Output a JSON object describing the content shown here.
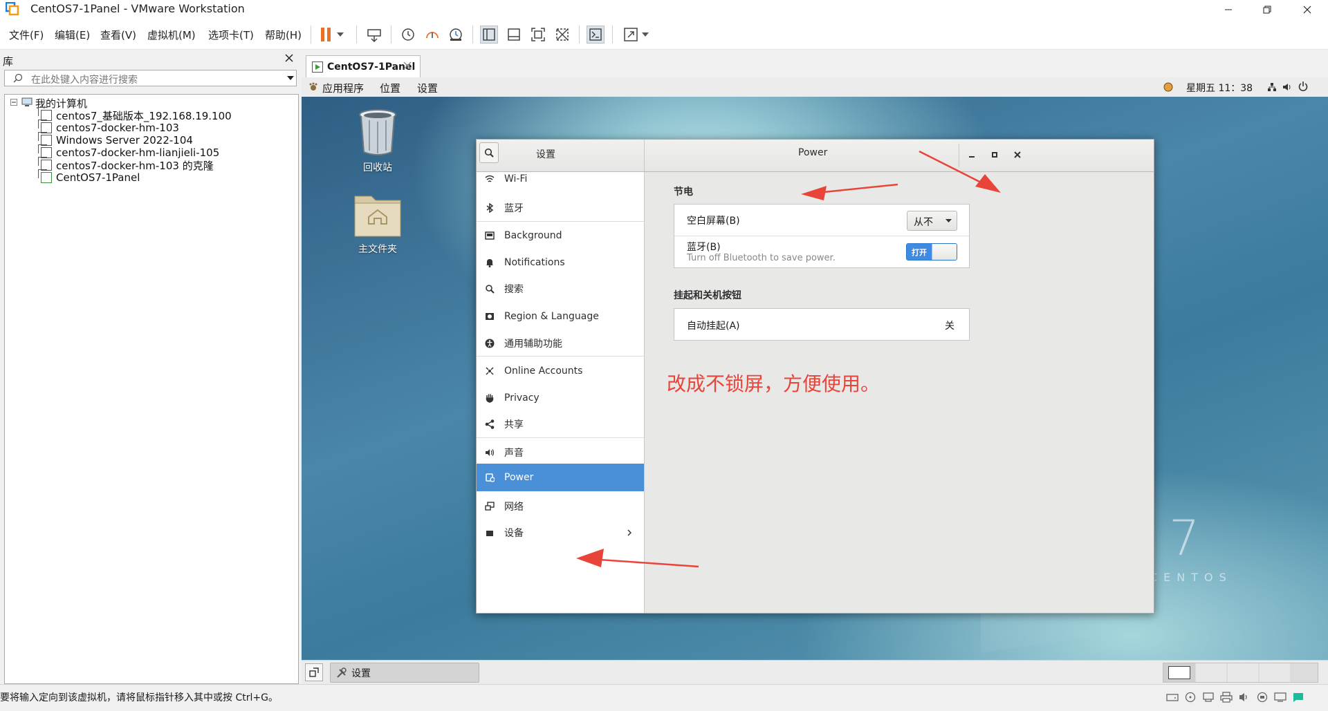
{
  "window": {
    "title": "CentOS7-1Panel - VMware Workstation"
  },
  "menu": [
    "文件(F)",
    "编辑(E)",
    "查看(V)",
    "虚拟机(M)",
    "选项卡(T)",
    "帮助(H)"
  ],
  "library": {
    "title": "库",
    "search_placeholder": "在此处键入内容进行搜索",
    "root": "我的计算机",
    "items": [
      "centos7_基础版本_192.168.19.100",
      "centos7-docker-hm-103",
      "Windows Server 2022-104",
      "centos7-docker-hm-lianjieli-105",
      "centos7-docker-hm-103 的克隆",
      "CentOS7-1Panel"
    ]
  },
  "tab": {
    "label": "CentOS7-1Panel"
  },
  "gnome": {
    "apps": "应用程序",
    "places": "位置",
    "settings": "设置",
    "clock": "星期五 11：38"
  },
  "desktop": {
    "trash": "回收站",
    "home": "主文件夹",
    "brand_num": "7",
    "brand_text": "CENTOS"
  },
  "settings": {
    "title": "设置",
    "panel_title": "Power",
    "sidebar": [
      "Wi-Fi",
      "蓝牙",
      "Background",
      "Notifications",
      "搜索",
      "Region & Language",
      "通用辅助功能",
      "Online Accounts",
      "Privacy",
      "共享",
      "声音",
      "Power",
      "网络",
      "设备"
    ],
    "selected": "Power",
    "power_saving": {
      "heading": "节电",
      "blank_screen_label": "空白屏幕(B)",
      "blank_screen_value": "从不",
      "bluetooth_label": "蓝牙(B)",
      "bluetooth_desc": "Turn off Bluetooth to save power.",
      "bluetooth_toggle": "打开"
    },
    "suspend": {
      "heading": "挂起和关机按钮",
      "auto_label": "自动挂起(A)",
      "auto_value": "关"
    }
  },
  "annotation": {
    "text": "改成不锁屏，方便使用。",
    "color": "#e8443a"
  },
  "taskbar": {
    "item": "设置"
  },
  "statusbar": {
    "text": "要将输入定向到该虚拟机，请将鼠标指针移入其中或按 Ctrl+G。"
  }
}
